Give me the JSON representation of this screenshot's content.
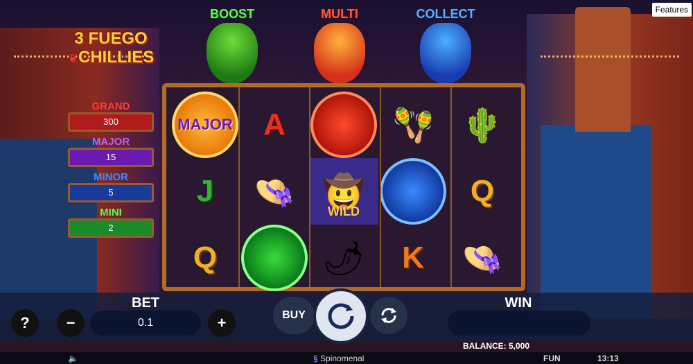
{
  "header": {
    "features_label": "Features"
  },
  "logo": {
    "line1": "3 FUEGO",
    "line2": "CHILLIES"
  },
  "bonus_peppers": [
    {
      "label": "BOOST",
      "color": "#5cff4a"
    },
    {
      "label": "MULTI",
      "color": "#ff5a3a"
    },
    {
      "label": "COLLECT",
      "color": "#5ab0ff"
    }
  ],
  "jackpots": [
    {
      "name": "GRAND",
      "value": "300",
      "name_color": "#ff3a3a",
      "box_color": "#b01a1a"
    },
    {
      "name": "MAJOR",
      "value": "15",
      "name_color": "#c05aff",
      "box_color": "#6a1ab0"
    },
    {
      "name": "MINOR",
      "value": "5",
      "name_color": "#3a8aff",
      "box_color": "#1a3a9a"
    },
    {
      "name": "MINI",
      "value": "2",
      "name_color": "#5cff4a",
      "box_color": "#1a8a2a"
    }
  ],
  "reels": {
    "row1": [
      "major-coin",
      "A",
      "red-coin",
      "maracas",
      "cactus"
    ],
    "row2": [
      "J",
      "sombrero",
      "wild-mariachi",
      "blue-coin",
      "Q"
    ],
    "row3": [
      "Q",
      "green-coin",
      "hot-sauce",
      "K",
      "sombrero"
    ],
    "coin_label": "MAJOR",
    "wild_label": "WILD"
  },
  "controls": {
    "bet_label": "BET",
    "bet_value": "0.1",
    "help_label": "?",
    "minus_label": "−",
    "plus_label": "+",
    "buy_label": "BUY",
    "win_label": "WIN"
  },
  "status": {
    "balance": "BALANCE: 5,000",
    "brand": "Spinomenal",
    "mode": "FUN",
    "time": "13:13"
  }
}
